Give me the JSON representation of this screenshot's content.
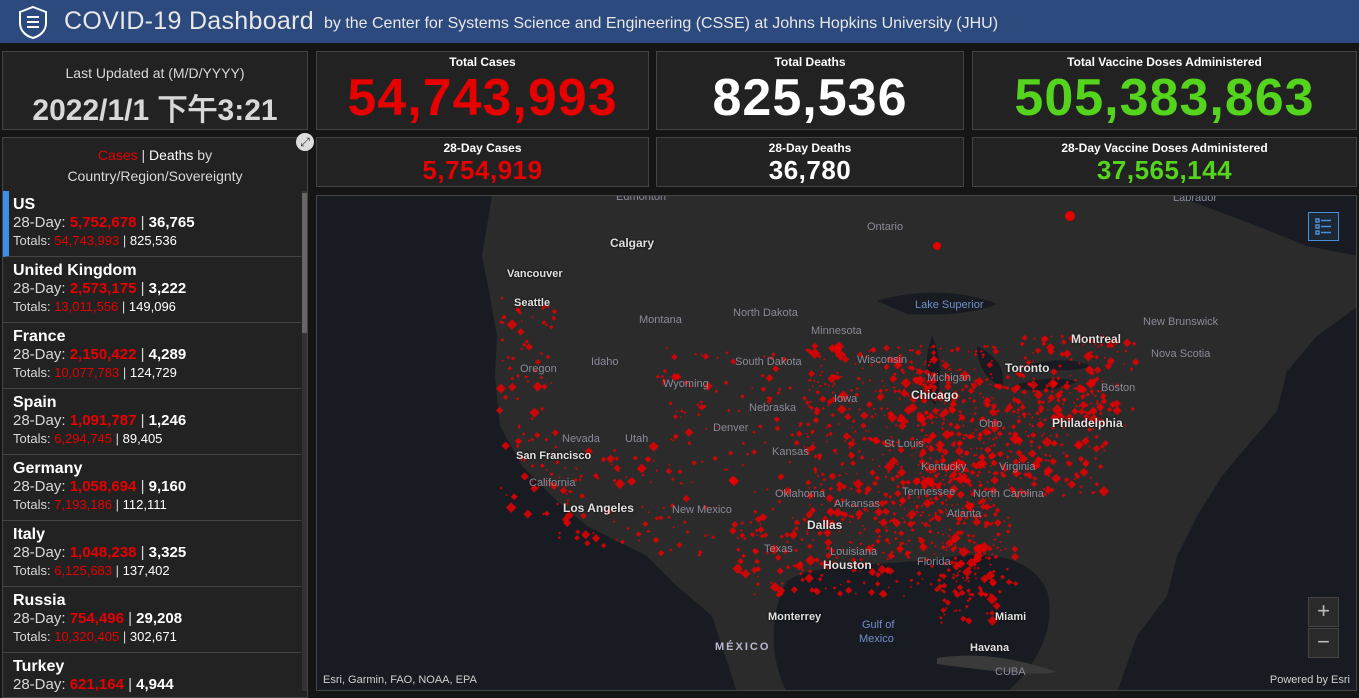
{
  "header": {
    "title": "COVID-19 Dashboard",
    "subtitle": "by the Center for Systems Science and Engineering (CSSE) at Johns Hopkins University (JHU)"
  },
  "last_updated": {
    "label": "Last Updated at (M/D/YYYY)",
    "value": "2022/1/1 下午3:21"
  },
  "stats": {
    "total_cases": {
      "label": "Total Cases",
      "value": "54,743,993"
    },
    "total_deaths": {
      "label": "Total Deaths",
      "value": "825,536"
    },
    "total_vaccine": {
      "label": "Total Vaccine Doses Administered",
      "value": "505,383,863"
    },
    "cases_28": {
      "label": "28-Day Cases",
      "value": "5,754,919"
    },
    "deaths_28": {
      "label": "28-Day Deaths",
      "value": "36,780"
    },
    "vaccine_28": {
      "label": "28-Day Vaccine Doses Administered",
      "value": "37,565,144"
    }
  },
  "list": {
    "title_cases": "Cases",
    "title_sep": " | ",
    "title_deaths": "Deaths",
    "title_rest1": " by",
    "title_rest2": "Country/Region/Sovereignty",
    "prefix_28": "28-Day: ",
    "prefix_totals": "Totals: ",
    "sep": " | ",
    "items": [
      {
        "name": "US",
        "cases28": "5,752,678",
        "deaths28": "36,765",
        "cases": "54,743,993",
        "deaths": "825,536"
      },
      {
        "name": "United Kingdom",
        "cases28": "2,573,175",
        "deaths28": "3,222",
        "cases": "13,011,556",
        "deaths": "149,096"
      },
      {
        "name": "France",
        "cases28": "2,150,422",
        "deaths28": "4,289",
        "cases": "10,077,783",
        "deaths": "124,729"
      },
      {
        "name": "Spain",
        "cases28": "1,091,787",
        "deaths28": "1,246",
        "cases": "6,294,745",
        "deaths": "89,405"
      },
      {
        "name": "Germany",
        "cases28": "1,058,694",
        "deaths28": "9,160",
        "cases": "7,193,186",
        "deaths": "112,111"
      },
      {
        "name": "Italy",
        "cases28": "1,048,238",
        "deaths28": "3,325",
        "cases": "6,125,683",
        "deaths": "137,402"
      },
      {
        "name": "Russia",
        "cases28": "754,496",
        "deaths28": "29,208",
        "cases": "10,320,405",
        "deaths": "302,671"
      },
      {
        "name": "Turkey",
        "cases28": "621,164",
        "deaths28": "4,944",
        "cases": "",
        "deaths": ""
      }
    ]
  },
  "map": {
    "places": {
      "edmonton": "Edmonton",
      "calgary": "Calgary",
      "vancouver": "Vancouver",
      "seattle": "Seattle",
      "ontario": "Ontario",
      "montreal": "Montreal",
      "toronto": "Toronto",
      "boston": "Boston",
      "new_brunswick": "New Brunswick",
      "nova_scotia": "Nova Scotia",
      "labrador": "Labrador",
      "lake_superior": "Lake Superior",
      "montana": "Montana",
      "north_dakota": "North Dakota",
      "minnesota": "Minnesota",
      "oregon": "Oregon",
      "idaho": "Idaho",
      "south_dakota": "South Dakota",
      "wyoming": "Wyoming",
      "nebraska": "Nebraska",
      "iowa": "Iowa",
      "chicago": "Chicago",
      "nevada": "Nevada",
      "utah": "Utah",
      "denver": "Denver",
      "san_francisco": "San Francisco",
      "california": "California",
      "kansas": "Kansas",
      "st_louis": "St Louis",
      "kentucky": "Kentucky",
      "virginia": "Virginia",
      "philadelphia": "Philadelphia",
      "los_angeles": "Los Angeles",
      "new_mexico": "New Mexico",
      "oklahoma": "Oklahoma",
      "arkansas": "Arkansas",
      "tennessee": "Tennessee",
      "north_carolina": "North Carolina",
      "atlanta": "Atlanta",
      "dallas": "Dallas",
      "texas": "Texas",
      "louisiana": "Louisiana",
      "houston": "Houston",
      "florida": "Florida",
      "monterrey": "Monterrey",
      "gulf": "Gulf of",
      "mexico_gulf": "Mexico",
      "miami": "Miami",
      "mexico": "MÉXICO",
      "havana": "Havana",
      "cuba": "CUBA",
      "michigan": "Michigan",
      "wisconsin": "Wisconsin",
      "ohio": "Ohio"
    },
    "attribution": "Esri, Garmin, FAO, NOAA, EPA",
    "powered": "Powered by Esri",
    "zoom_in": "+",
    "zoom_out": "−",
    "colors": {
      "marker": "#e60000",
      "land": "#2b2b2b",
      "water": "#181c22"
    },
    "icons": [
      "legend-list-icon",
      "expand-icon",
      "jhu-shield-icon"
    ]
  }
}
